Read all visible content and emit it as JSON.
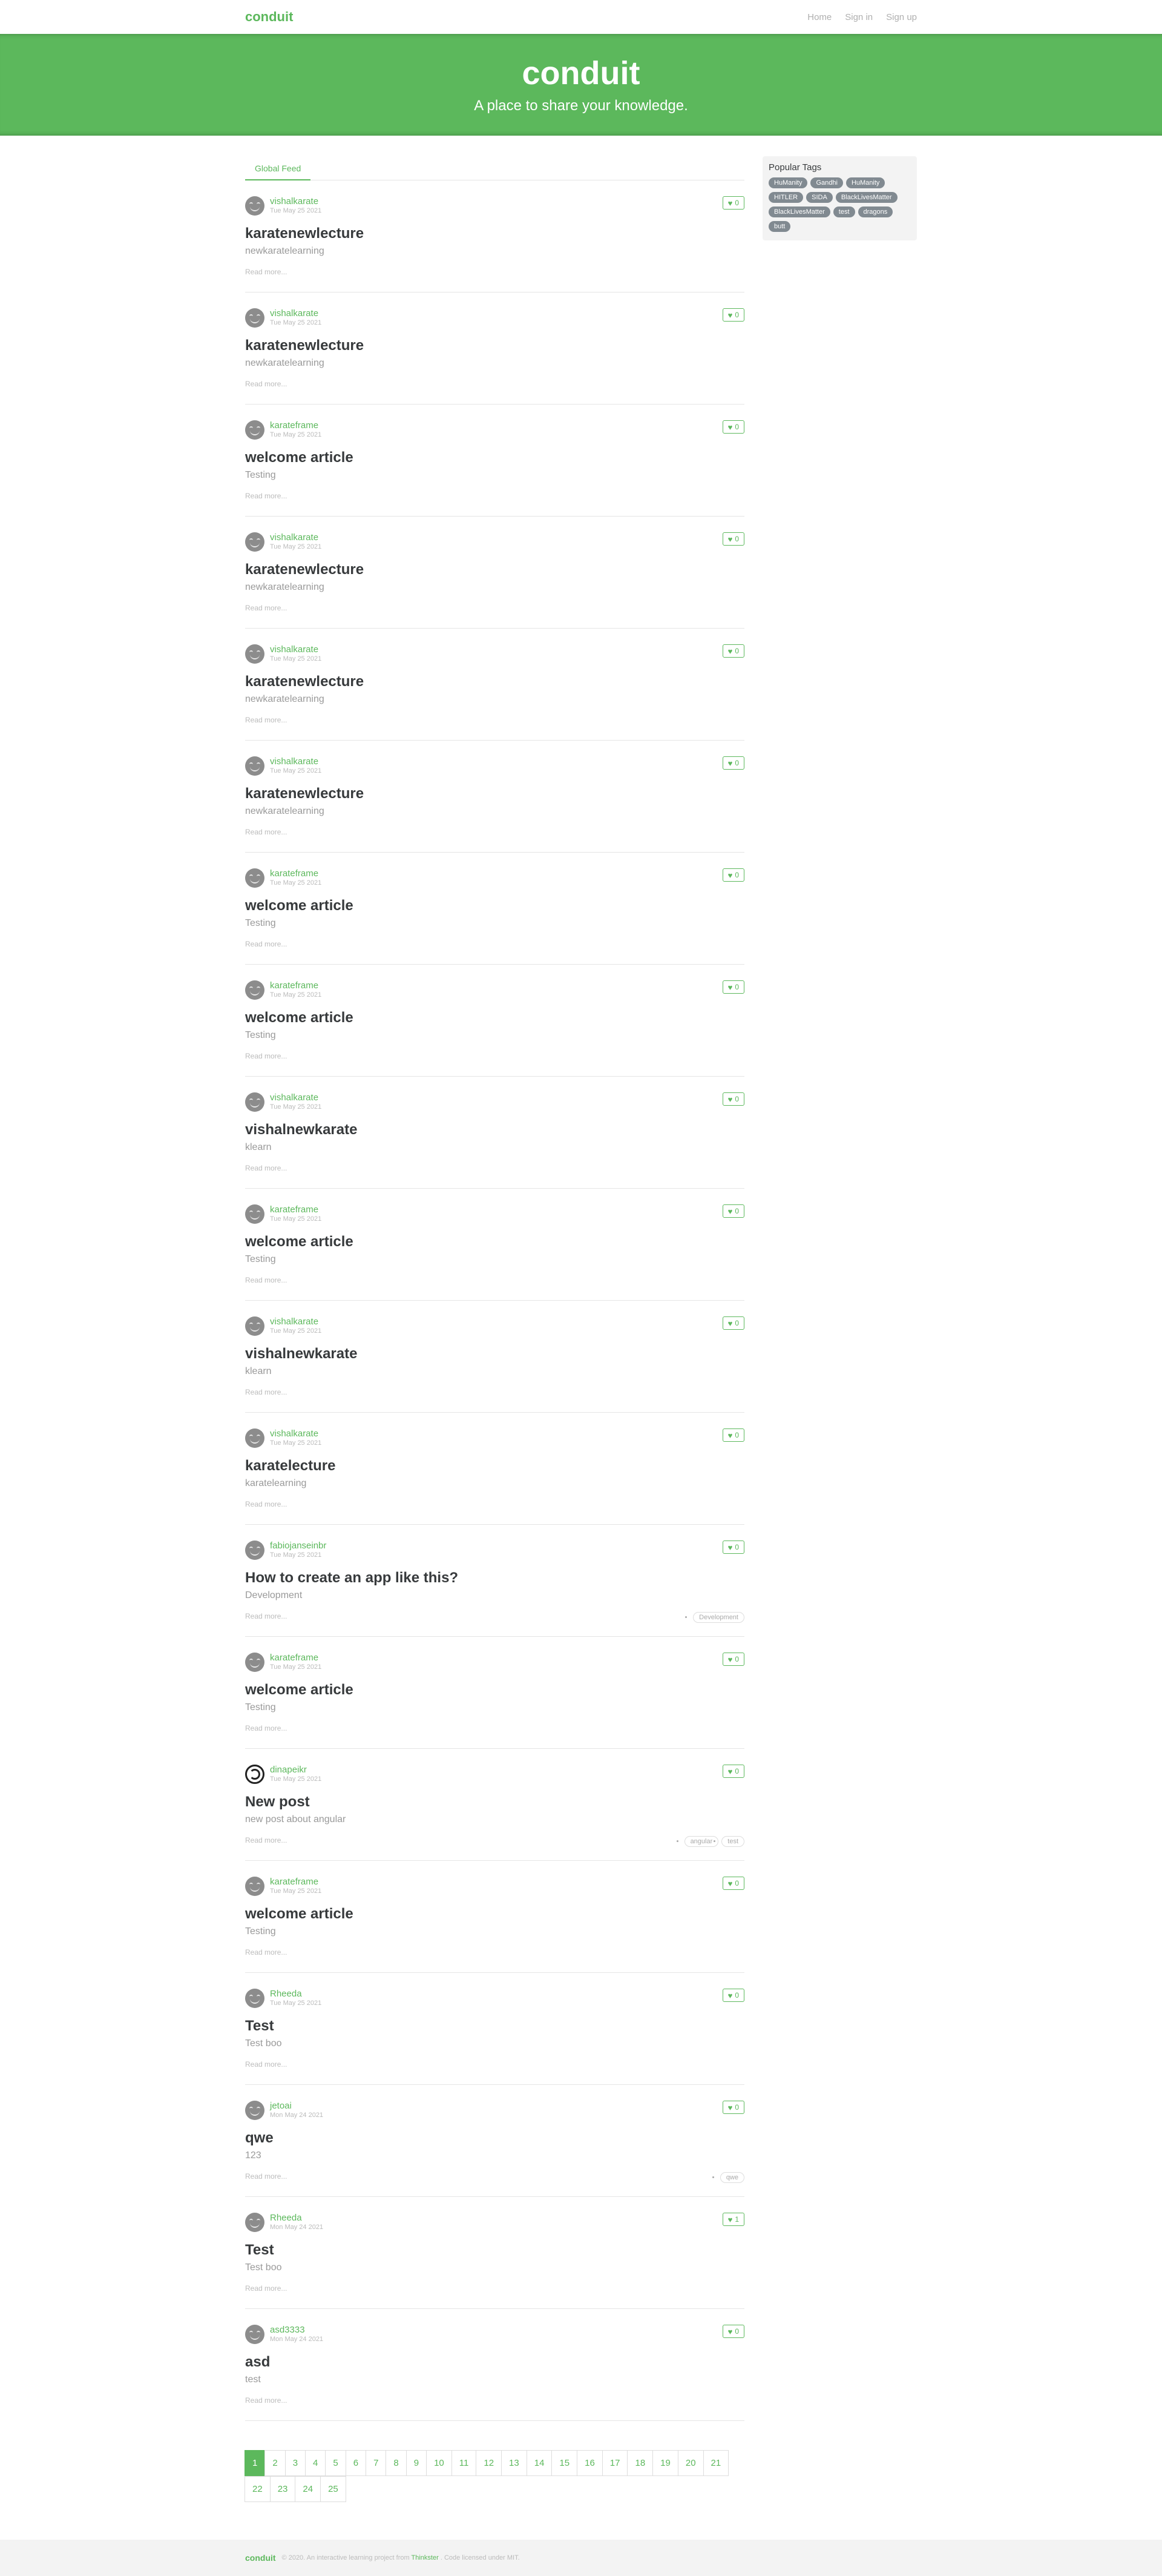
{
  "navbar": {
    "brand": "conduit",
    "links": [
      "Home",
      "Sign in",
      "Sign up"
    ]
  },
  "banner": {
    "title": "conduit",
    "subtitle": "A place to share your knowledge."
  },
  "feed": {
    "tab": "Global Feed",
    "read_more": "Read more...",
    "articles": [
      {
        "author": "vishalkarate",
        "date": "Tue May 25 2021",
        "likes": "0",
        "title": "karatenewlecture",
        "description": "newkaratelearning",
        "tags": []
      },
      {
        "author": "vishalkarate",
        "date": "Tue May 25 2021",
        "likes": "0",
        "title": "karatenewlecture",
        "description": "newkaratelearning",
        "tags": []
      },
      {
        "author": "karateframe",
        "date": "Tue May 25 2021",
        "likes": "0",
        "title": "welcome article",
        "description": "Testing",
        "tags": []
      },
      {
        "author": "vishalkarate",
        "date": "Tue May 25 2021",
        "likes": "0",
        "title": "karatenewlecture",
        "description": "newkaratelearning",
        "tags": []
      },
      {
        "author": "vishalkarate",
        "date": "Tue May 25 2021",
        "likes": "0",
        "title": "karatenewlecture",
        "description": "newkaratelearning",
        "tags": []
      },
      {
        "author": "vishalkarate",
        "date": "Tue May 25 2021",
        "likes": "0",
        "title": "karatenewlecture",
        "description": "newkaratelearning",
        "tags": []
      },
      {
        "author": "karateframe",
        "date": "Tue May 25 2021",
        "likes": "0",
        "title": "welcome article",
        "description": "Testing",
        "tags": []
      },
      {
        "author": "karateframe",
        "date": "Tue May 25 2021",
        "likes": "0",
        "title": "welcome article",
        "description": "Testing",
        "tags": []
      },
      {
        "author": "vishalkarate",
        "date": "Tue May 25 2021",
        "likes": "0",
        "title": "vishalnewkarate",
        "description": "klearn",
        "tags": []
      },
      {
        "author": "karateframe",
        "date": "Tue May 25 2021",
        "likes": "0",
        "title": "welcome article",
        "description": "Testing",
        "tags": []
      },
      {
        "author": "vishalkarate",
        "date": "Tue May 25 2021",
        "likes": "0",
        "title": "vishalnewkarate",
        "description": "klearn",
        "tags": []
      },
      {
        "author": "vishalkarate",
        "date": "Tue May 25 2021",
        "likes": "0",
        "title": "karatelecture",
        "description": "karatelearning",
        "tags": []
      },
      {
        "author": "fabiojanseinbr",
        "date": "Tue May 25 2021",
        "likes": "0",
        "title": "How to create an app like this?",
        "description": "Development",
        "tags": [
          "Development"
        ]
      },
      {
        "author": "karateframe",
        "date": "Tue May 25 2021",
        "likes": "0",
        "title": "welcome article",
        "description": "Testing",
        "tags": []
      },
      {
        "author": "dinapeikr",
        "date": "Tue May 25 2021",
        "likes": "0",
        "title": "New post",
        "description": "new post about angular",
        "tags": [
          "angular",
          "test"
        ],
        "avatar": "swirl"
      },
      {
        "author": "karateframe",
        "date": "Tue May 25 2021",
        "likes": "0",
        "title": "welcome article",
        "description": "Testing",
        "tags": []
      },
      {
        "author": "Rheeda",
        "date": "Tue May 25 2021",
        "likes": "0",
        "title": "Test",
        "description": "Test boo",
        "tags": []
      },
      {
        "author": "jetoai",
        "date": "Mon May 24 2021",
        "likes": "0",
        "title": "qwe",
        "description": "123",
        "tags": [
          "qwe"
        ]
      },
      {
        "author": "Rheeda",
        "date": "Mon May 24 2021",
        "likes": "1",
        "title": "Test",
        "description": "Test boo",
        "tags": []
      },
      {
        "author": "asd3333",
        "date": "Mon May 24 2021",
        "likes": "0",
        "title": "asd",
        "description": "test",
        "tags": []
      }
    ]
  },
  "sidebar": {
    "title": "Popular Tags",
    "tags": [
      "HuManity",
      "Gandhi",
      "HuManity",
      "HITLER",
      "SIDA",
      "BlackLivesMatter",
      "BlackLivesMatter",
      "test",
      "dragons",
      "butt"
    ]
  },
  "pagination": {
    "active": "1",
    "pages": [
      "1",
      "2",
      "3",
      "4",
      "5",
      "6",
      "7",
      "8",
      "9",
      "10",
      "11",
      "12",
      "13",
      "14",
      "15",
      "16",
      "17",
      "18",
      "19",
      "20",
      "21",
      "22",
      "23",
      "24",
      "25"
    ]
  },
  "footer": {
    "logo": "conduit",
    "text_before": "© 2020. An interactive learning project from",
    "link": "Thinkster",
    "text_after": ". Code licensed under MIT."
  },
  "colors": {
    "brand": "#5cb85c",
    "tag_pill": "#818a91"
  }
}
